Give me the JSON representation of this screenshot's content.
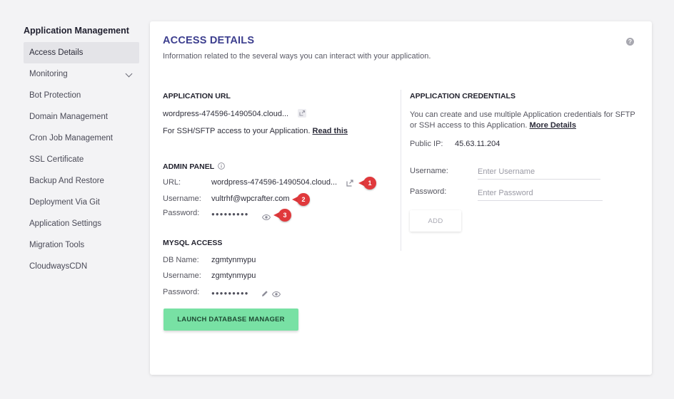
{
  "sidebar": {
    "title": "Application Management",
    "items": [
      {
        "label": "Access Details"
      },
      {
        "label": "Monitoring"
      },
      {
        "label": "Bot Protection"
      },
      {
        "label": "Domain Management"
      },
      {
        "label": "Cron Job Management"
      },
      {
        "label": "SSL Certificate"
      },
      {
        "label": "Backup And Restore"
      },
      {
        "label": "Deployment Via Git"
      },
      {
        "label": "Application Settings"
      },
      {
        "label": "Migration Tools"
      },
      {
        "label": "CloudwaysCDN"
      }
    ]
  },
  "card": {
    "title": "ACCESS DETAILS",
    "subtitle": "Information related to the several ways you can interact with your application.",
    "help": "?"
  },
  "app_url": {
    "heading": "APPLICATION URL",
    "url": "wordpress-474596-1490504.cloud...",
    "ssh_note": "For SSH/SFTP access to your Application.",
    "read_this": "Read this"
  },
  "admin_panel": {
    "heading": "ADMIN PANEL",
    "url_label": "URL:",
    "url_value": "wordpress-474596-1490504.cloud...",
    "username_label": "Username:",
    "username_value": "vultrhf@wpcrafter.com",
    "password_label": "Password:",
    "password_value": "●●●●●●●●●"
  },
  "mysql": {
    "heading": "MYSQL ACCESS",
    "db_label": "DB Name:",
    "db_value": "zgmtynmypu",
    "username_label": "Username:",
    "username_value": "zgmtynmypu",
    "password_label": "Password:",
    "password_value": "●●●●●●●●●",
    "launch_button": "LAUNCH DATABASE MANAGER"
  },
  "credentials": {
    "heading": "APPLICATION CREDENTIALS",
    "desc_line1": "You can create and use multiple Application credentials for SFTP",
    "desc_line2": "or SSH access to this Application.",
    "more_details": "More Details",
    "public_ip_label": "Public IP:",
    "public_ip_value": "45.63.11.204",
    "username_label": "Username:",
    "username_placeholder": "Enter Username",
    "password_label": "Password:",
    "password_placeholder": "Enter Password",
    "add_button": "ADD"
  },
  "annotations": [
    "1",
    "2",
    "3"
  ],
  "colors": {
    "accent_title": "#3c3e8e",
    "launch_button": "#78e1a4",
    "badge": "#e0393c"
  }
}
